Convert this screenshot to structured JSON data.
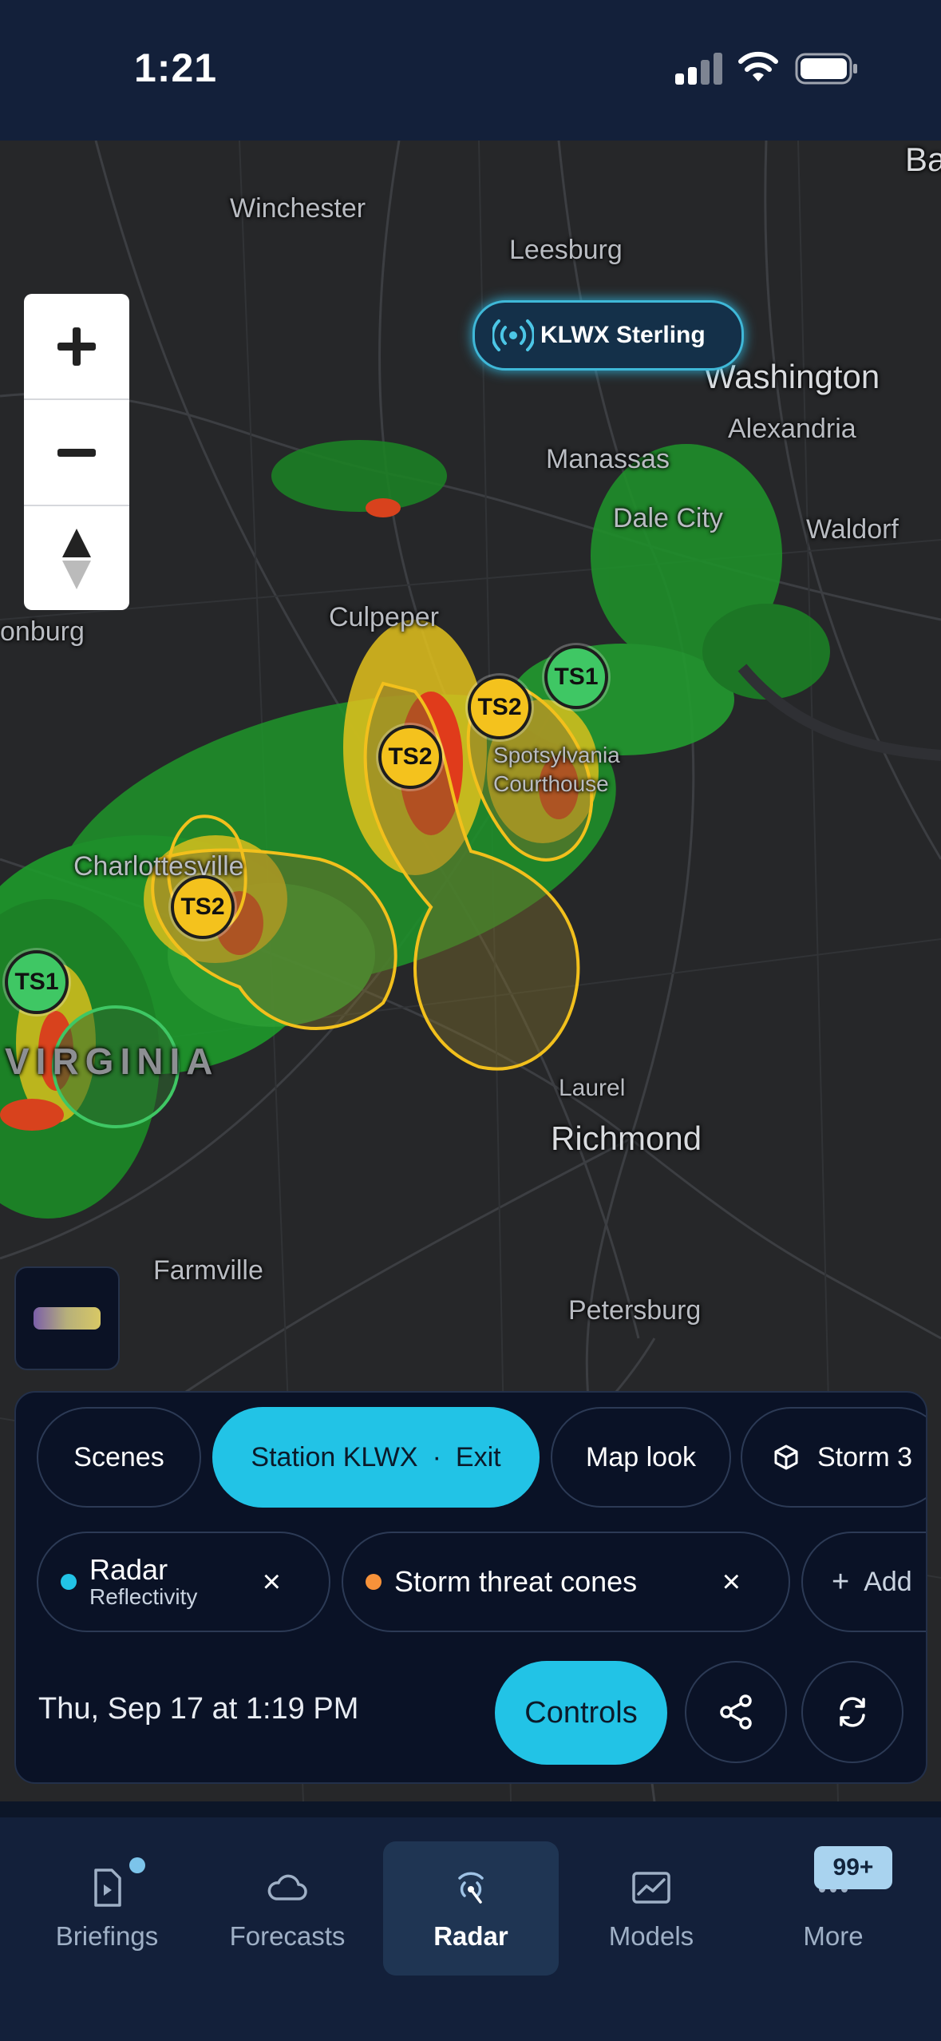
{
  "status_bar": {
    "time": "1:21"
  },
  "map": {
    "labels": {
      "winchester": "Winchester",
      "leesburg": "Leesburg",
      "washington": "Washington",
      "alexandria": "Alexandria",
      "manassas": "Manassas",
      "dale_city": "Dale City",
      "waldorf": "Waldorf",
      "culpeper": "Culpeper",
      "onburg": "onburg",
      "ba": "Ba",
      "spotsylvania": "Spotsylvania",
      "courthouse": "Courthouse",
      "charlottesville": "Charlottesville",
      "virginia": "VIRGINIA",
      "laurel": "Laurel",
      "richmond": "Richmond",
      "farmville": "Farmville",
      "petersburg": "Petersburg"
    },
    "station": {
      "label": "KLWX Sterling"
    },
    "storms": [
      {
        "id": "TS1",
        "category": "ts1"
      },
      {
        "id": "TS2",
        "category": "ts2"
      },
      {
        "id": "TS2",
        "category": "ts2"
      },
      {
        "id": "TS2",
        "category": "ts2"
      },
      {
        "id": "TS1",
        "category": "ts1"
      }
    ]
  },
  "panel": {
    "chips": {
      "scenes": "Scenes",
      "station": "Station KLWX",
      "station_sep": "·",
      "station_exit": "Exit",
      "map_look": "Map look",
      "storm": "Storm 3"
    },
    "layers": {
      "radar_title": "Radar",
      "radar_sub": "Reflectivity",
      "threat": "Storm threat cones",
      "add": "Add",
      "remove": "×",
      "plus": "+"
    },
    "date": "Thu, Sep 17 at 1:19 PM",
    "controls": "Controls"
  },
  "tabs": {
    "briefings": "Briefings",
    "forecasts": "Forecasts",
    "radar": "Radar",
    "models": "Models",
    "more": "More",
    "badge": "99+"
  },
  "colors": {
    "accent": "#22c3e6",
    "ts2": "#f4c21d",
    "ts1": "#3fc764",
    "radar_dot": "#22c3e6",
    "threat_dot": "#f7923a"
  }
}
